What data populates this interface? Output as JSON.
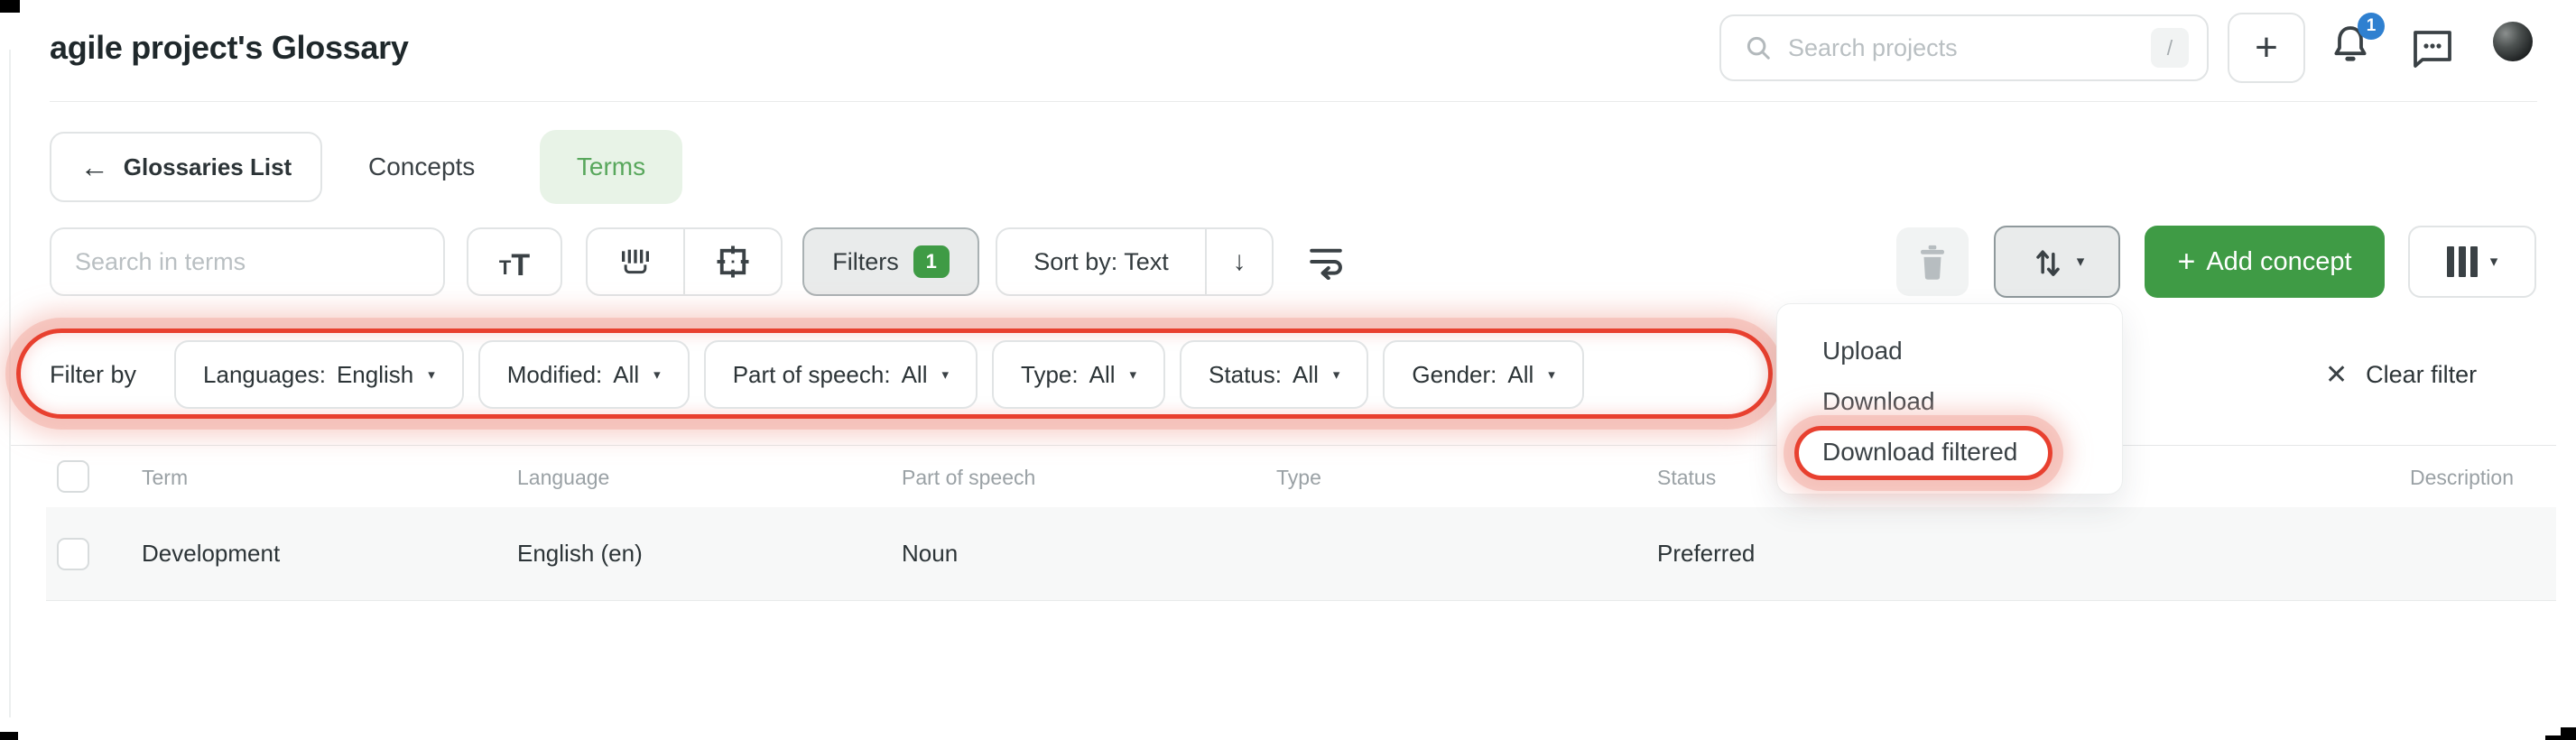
{
  "header": {
    "title": "agile project's Glossary",
    "search_placeholder": "Search projects",
    "search_shortcut": "/",
    "notifications": "1"
  },
  "nav": {
    "back_label": "Glossaries List",
    "tabs": [
      {
        "label": "Concepts",
        "active": false
      },
      {
        "label": "Terms",
        "active": true
      }
    ]
  },
  "toolbar": {
    "search_placeholder": "Search in terms",
    "filters_label": "Filters",
    "filters_count": "1",
    "sort_label": "Sort by: Text",
    "add_concept_label": "Add concept"
  },
  "filter_bar": {
    "label": "Filter by",
    "filters": [
      {
        "name": "Languages:",
        "value": "English"
      },
      {
        "name": "Modified:",
        "value": "All"
      },
      {
        "name": "Part of speech:",
        "value": "All"
      },
      {
        "name": "Type:",
        "value": "All"
      },
      {
        "name": "Status:",
        "value": "All"
      },
      {
        "name": "Gender:",
        "value": "All"
      }
    ],
    "clear_label": "Clear filter"
  },
  "menu": {
    "items": [
      {
        "label": "Upload"
      },
      {
        "label": "Download"
      },
      {
        "label": "Download filtered",
        "highlighted": true
      }
    ]
  },
  "table": {
    "columns": [
      "Term",
      "Language",
      "Part of speech",
      "Type",
      "Status",
      "Description"
    ],
    "rows": [
      {
        "term": "Development",
        "language": "English (en)",
        "part_of_speech": "Noun",
        "type": "",
        "status": "Preferred",
        "description": ""
      }
    ]
  },
  "icons": {
    "plus": "+",
    "arrow_left": "←",
    "arrow_down": "↓",
    "caret_down": "▾",
    "close": "✕",
    "case_small": "T",
    "case_large": "T"
  },
  "colors": {
    "accent_green": "#3f9b45",
    "tab_active_bg": "#e8f3e7",
    "tab_active_text": "#58a75c",
    "annotation_red": "#e8402f",
    "annotation_glow": "#f3b0a8",
    "badge_blue": "#2f80d0",
    "row_bg": "#f7f8f8"
  }
}
